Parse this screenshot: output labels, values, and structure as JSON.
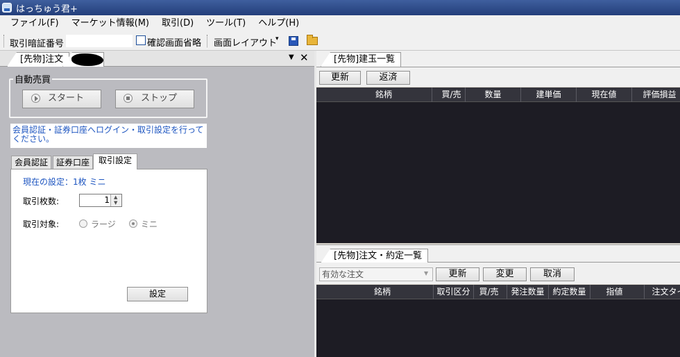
{
  "title": "はっちゅう君+",
  "menu": [
    "ファイル(F)",
    "マーケット情報(M)",
    "取引(D)",
    "ツール(T)",
    "ヘルプ(H)"
  ],
  "toolbar": {
    "trade_password_label": "取引暗証番号",
    "trade_password_value": "",
    "skip_confirm_label": "確認画面省略",
    "layout_label": "画面レイアウト",
    "layout_arrow": "▾"
  },
  "left_pane": {
    "tabs": [
      "[先物]注文"
    ],
    "close": "✕",
    "menu_arrow": "▼",
    "auto_trade": {
      "label": "自動売買",
      "start": "スタート",
      "stop": "ストップ"
    },
    "message": "会員認証・証券口座へログイン・取引設定を行ってください。",
    "subtabs": [
      "会員認証",
      "証券口座",
      "取引設定"
    ],
    "settings": {
      "current": "現在の設定：1枚 ミニ",
      "count_label": "取引枚数:",
      "count_value": "1",
      "spin_up": "▲",
      "spin_down": "▼",
      "target_label": "取引対象:",
      "option_large": "ラージ",
      "option_mini": "ミニ",
      "selected": "ミニ",
      "set_button": "設定"
    }
  },
  "positions": {
    "tab": "[先物]建玉一覧",
    "buttons": {
      "refresh": "更新",
      "repay": "返済"
    },
    "columns": [
      "銘柄",
      "買/売",
      "数量",
      "建単価",
      "現在値",
      "評価損益"
    ],
    "rows": []
  },
  "orders": {
    "tab": "[先物]注文・約定一覧",
    "filter": "有効な注文",
    "buttons": {
      "refresh": "更新",
      "modify": "変更",
      "cancel": "取消"
    },
    "columns": [
      "銘柄",
      "取引区分",
      "買/売",
      "発注数量",
      "約定数量",
      "指値",
      "注文タイ"
    ],
    "rows": []
  }
}
